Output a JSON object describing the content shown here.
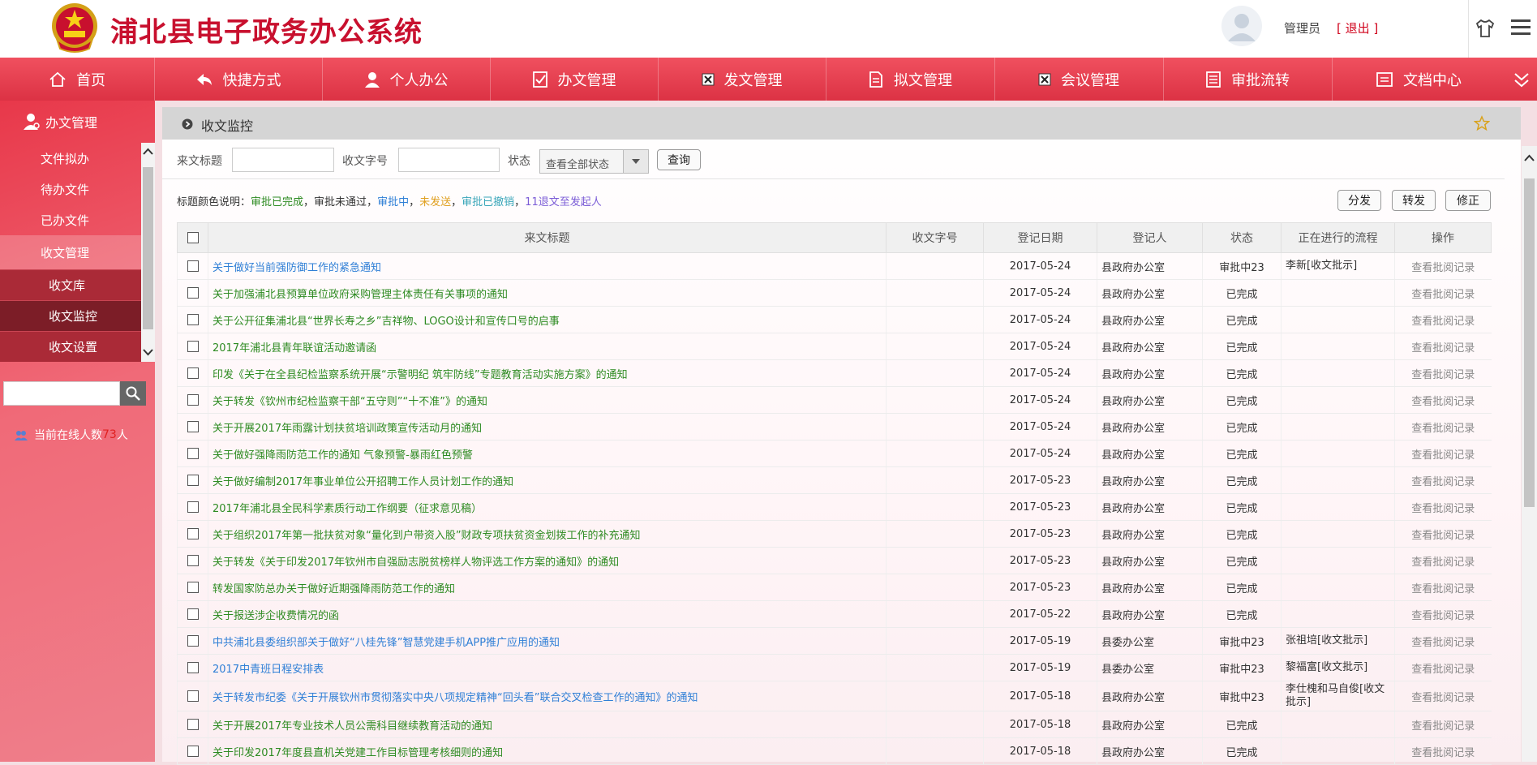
{
  "header": {
    "title": "浦北县电子政务办公系统",
    "user_name": "管理员",
    "logout_label": "[ 退出 ]"
  },
  "nav": {
    "items": [
      {
        "label": "首页",
        "icon": "home-icon"
      },
      {
        "label": "快捷方式",
        "icon": "shortcut-icon"
      },
      {
        "label": "个人办公",
        "icon": "user-icon"
      },
      {
        "label": "办文管理",
        "icon": "check-doc-icon"
      },
      {
        "label": "发文管理",
        "icon": "x-box-icon"
      },
      {
        "label": "拟文管理",
        "icon": "doc-icon"
      },
      {
        "label": "会议管理",
        "icon": "x-box-icon"
      },
      {
        "label": "审批流转",
        "icon": "list-doc-icon"
      },
      {
        "label": "文档中心",
        "icon": "folder-icon"
      }
    ]
  },
  "sidebar": {
    "heading": "办文管理",
    "items": [
      {
        "label": "文件拟办"
      },
      {
        "label": "待办文件"
      },
      {
        "label": "已办文件"
      },
      {
        "label": "收文管理"
      }
    ],
    "sub_items": [
      {
        "label": "收文库"
      },
      {
        "label": "收文监控"
      },
      {
        "label": "收文设置"
      }
    ],
    "search_placeholder": "",
    "online_prefix": "当前在线人数",
    "online_count": "73",
    "online_suffix": "人"
  },
  "panel": {
    "title": "收文监控"
  },
  "filter": {
    "title_label": "来文标题",
    "title_value": "",
    "docno_label": "收文字号",
    "docno_value": "",
    "status_label": "状态",
    "status_value": "查看全部状态",
    "query_label": "查询"
  },
  "legend": {
    "prefix": "标题颜色说明：",
    "items": [
      {
        "text": "审批已完成",
        "color": "#2e8b22"
      },
      {
        "text": "，",
        "color": "#333333"
      },
      {
        "text": "审批未通过",
        "color": "#333333"
      },
      {
        "text": "，",
        "color": "#333333"
      },
      {
        "text": "审批中",
        "color": "#2f7fd6"
      },
      {
        "text": "，",
        "color": "#333333"
      },
      {
        "text": "未发送",
        "color": "#e0a020"
      },
      {
        "text": "，",
        "color": "#333333"
      },
      {
        "text": "审批已撤销",
        "color": "#3aa6b9"
      },
      {
        "text": "，",
        "color": "#333333"
      },
      {
        "text": "11退文至发起人",
        "color": "#7b5cd6"
      }
    ]
  },
  "actions": {
    "distribute": "分发",
    "forward": "转发",
    "modify": "修正"
  },
  "colors": {
    "done": "#2e8b22",
    "pending": "#2f7fd6",
    "brand": "#e63c4d"
  },
  "table": {
    "headers": [
      "来文标题",
      "收文字号",
      "登记日期",
      "登记人",
      "状态",
      "正在进行的流程",
      "操作"
    ],
    "op_label": "查看批阅记录",
    "rows": [
      {
        "title": "关于做好当前强防御工作的紧急通知",
        "docno": "",
        "date": "2017-05-24",
        "reg": "县政府办公室",
        "status": "审批中23",
        "flow": "李新[收文批示]",
        "kind": "pending"
      },
      {
        "title": "关于加强浦北县预算单位政府采购管理主体责任有关事项的通知",
        "docno": "",
        "date": "2017-05-24",
        "reg": "县政府办公室",
        "status": "已完成",
        "flow": "",
        "kind": "done"
      },
      {
        "title": "关于公开征集浦北县“世界长寿之乡”吉祥物、LOGO设计和宣传口号的启事",
        "docno": "",
        "date": "2017-05-24",
        "reg": "县政府办公室",
        "status": "已完成",
        "flow": "",
        "kind": "done"
      },
      {
        "title": "2017年浦北县青年联谊活动邀请函",
        "docno": "",
        "date": "2017-05-24",
        "reg": "县政府办公室",
        "status": "已完成",
        "flow": "",
        "kind": "done"
      },
      {
        "title": "印发《关于在全县纪检监察系统开展“示警明纪 筑牢防线”专题教育活动实施方案》的通知",
        "docno": "",
        "date": "2017-05-24",
        "reg": "县政府办公室",
        "status": "已完成",
        "flow": "",
        "kind": "done"
      },
      {
        "title": "关于转发《钦州市纪检监察干部“五守则”“十不准”》的通知",
        "docno": "",
        "date": "2017-05-24",
        "reg": "县政府办公室",
        "status": "已完成",
        "flow": "",
        "kind": "done"
      },
      {
        "title": "关于开展2017年雨露计划扶贫培训政策宣传活动月的通知",
        "docno": "",
        "date": "2017-05-24",
        "reg": "县政府办公室",
        "status": "已完成",
        "flow": "",
        "kind": "done"
      },
      {
        "title": "关于做好强降雨防范工作的通知 气象预警-暴雨红色预警",
        "docno": "",
        "date": "2017-05-24",
        "reg": "县政府办公室",
        "status": "已完成",
        "flow": "",
        "kind": "done"
      },
      {
        "title": "关于做好编制2017年事业单位公开招聘工作人员计划工作的通知",
        "docno": "",
        "date": "2017-05-23",
        "reg": "县政府办公室",
        "status": "已完成",
        "flow": "",
        "kind": "done"
      },
      {
        "title": "2017年浦北县全民科学素质行动工作纲要（征求意见稿）",
        "docno": "",
        "date": "2017-05-23",
        "reg": "县政府办公室",
        "status": "已完成",
        "flow": "",
        "kind": "done"
      },
      {
        "title": "关于组织2017年第一批扶贫对象“量化到户带资入股”财政专项扶贫资金划拨工作的补充通知",
        "docno": "",
        "date": "2017-05-23",
        "reg": "县政府办公室",
        "status": "已完成",
        "flow": "",
        "kind": "done"
      },
      {
        "title": "关于转发《关于印发2017年钦州市自强励志脱贫榜样人物评选工作方案的通知》的通知",
        "docno": "",
        "date": "2017-05-23",
        "reg": "县政府办公室",
        "status": "已完成",
        "flow": "",
        "kind": "done"
      },
      {
        "title": "转发国家防总办关于做好近期强降雨防范工作的通知",
        "docno": "",
        "date": "2017-05-23",
        "reg": "县政府办公室",
        "status": "已完成",
        "flow": "",
        "kind": "done"
      },
      {
        "title": "关于报送涉企收费情况的函",
        "docno": "",
        "date": "2017-05-22",
        "reg": "县政府办公室",
        "status": "已完成",
        "flow": "",
        "kind": "done"
      },
      {
        "title": "中共浦北县委组织部关于做好“八桂先锋”智慧党建手机APP推广应用的通知",
        "docno": "",
        "date": "2017-05-19",
        "reg": "县委办公室",
        "status": "审批中23",
        "flow": "张祖培[收文批示]",
        "kind": "pending"
      },
      {
        "title": "2017中青班日程安排表",
        "docno": "",
        "date": "2017-05-19",
        "reg": "县委办公室",
        "status": "审批中23",
        "flow": "黎福富[收文批示]",
        "kind": "pending"
      },
      {
        "title": "关于转发市纪委《关于开展钦州市贯彻落实中央八项规定精神“回头看”联合交叉检查工作的通知》的通知",
        "docno": "",
        "date": "2017-05-18",
        "reg": "县政府办公室",
        "status": "审批中23",
        "flow": "李仕槐和马自俊[收文批示]",
        "kind": "pending"
      },
      {
        "title": "关于开展2017年专业技术人员公需科目继续教育活动的通知",
        "docno": "",
        "date": "2017-05-18",
        "reg": "县政府办公室",
        "status": "已完成",
        "flow": "",
        "kind": "done"
      },
      {
        "title": "关于印发2017年度县直机关党建工作目标管理考核细则的通知",
        "docno": "",
        "date": "2017-05-18",
        "reg": "县政府办公室",
        "status": "已完成",
        "flow": "",
        "kind": "done"
      }
    ]
  }
}
